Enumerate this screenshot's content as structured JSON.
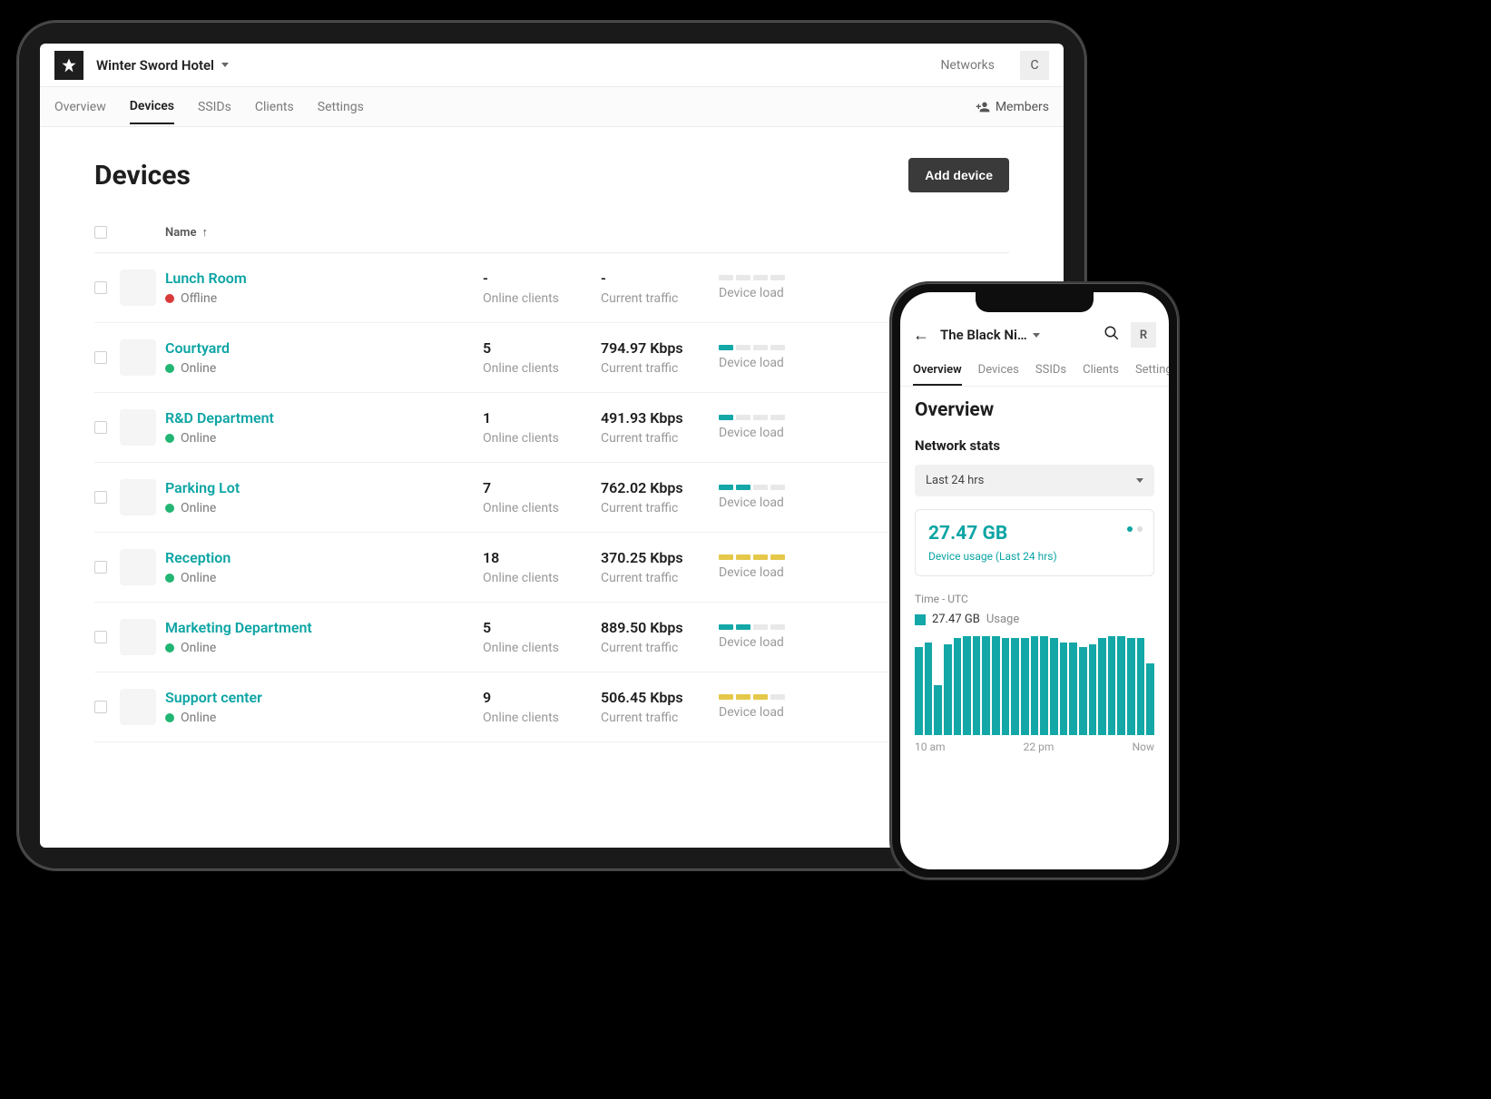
{
  "tablet": {
    "org_name": "Winter Sword Hotel",
    "networks_label": "Networks",
    "avatar_initial": "C",
    "tabs": [
      "Overview",
      "Devices",
      "SSIDs",
      "Clients",
      "Settings"
    ],
    "active_tab": "Devices",
    "members_label": "Members",
    "page_title": "Devices",
    "add_button": "Add device",
    "col_name": "Name",
    "online_clients_label": "Online clients",
    "current_traffic_label": "Current traffic",
    "device_load_label": "Device load",
    "devices": [
      {
        "name": "Lunch Room",
        "status": "Offline",
        "status_class": "offline",
        "clients": "-",
        "traffic": "-",
        "load_on": 0,
        "load_color": "teal"
      },
      {
        "name": "Courtyard",
        "status": "Online",
        "status_class": "online",
        "clients": "5",
        "traffic": "794.97 Kbps",
        "load_on": 1,
        "load_color": "teal"
      },
      {
        "name": "R&D Department",
        "status": "Online",
        "status_class": "online",
        "clients": "1",
        "traffic": "491.93 Kbps",
        "load_on": 1,
        "load_color": "teal"
      },
      {
        "name": "Parking Lot",
        "status": "Online",
        "status_class": "online",
        "clients": "7",
        "traffic": "762.02 Kbps",
        "load_on": 2,
        "load_color": "teal"
      },
      {
        "name": "Reception",
        "status": "Online",
        "status_class": "online",
        "clients": "18",
        "traffic": "370.25 Kbps",
        "load_on": 4,
        "load_color": "yellow"
      },
      {
        "name": "Marketing Department",
        "status": "Online",
        "status_class": "online",
        "clients": "5",
        "traffic": "889.50 Kbps",
        "load_on": 2,
        "load_color": "teal"
      },
      {
        "name": "Support center",
        "status": "Online",
        "status_class": "online",
        "clients": "9",
        "traffic": "506.45 Kbps",
        "load_on": 3,
        "load_color": "yellow"
      }
    ]
  },
  "phone": {
    "title": "The Black Ni…",
    "avatar_initial": "R",
    "tabs": [
      "Overview",
      "Devices",
      "SSIDs",
      "Clients",
      "Settings"
    ],
    "active_tab": "Overview",
    "page_title": "Overview",
    "section_title": "Network stats",
    "dropdown_value": "Last 24 hrs",
    "usage_value": "27.47 GB",
    "usage_sub": "Device usage (Last 24 hrs)",
    "time_label": "Time - UTC",
    "legend_value": "27.47 GB",
    "legend_label": "Usage",
    "xaxis": [
      "10 am",
      "22 pm",
      "Now"
    ]
  },
  "chart_data": {
    "type": "bar",
    "title": "Device usage (Last 24 hrs)",
    "ylabel": "Usage",
    "xlabel": "Time - UTC",
    "x_ticks": [
      "10 am",
      "22 pm",
      "Now"
    ],
    "total_usage_gb": 27.47,
    "values_rel": [
      0.88,
      0.93,
      0.5,
      0.91,
      0.97,
      0.99,
      0.99,
      0.99,
      0.99,
      0.97,
      0.97,
      0.97,
      0.99,
      0.99,
      0.97,
      0.93,
      0.93,
      0.88,
      0.91,
      0.97,
      0.99,
      0.99,
      0.97,
      0.97,
      0.72
    ]
  }
}
